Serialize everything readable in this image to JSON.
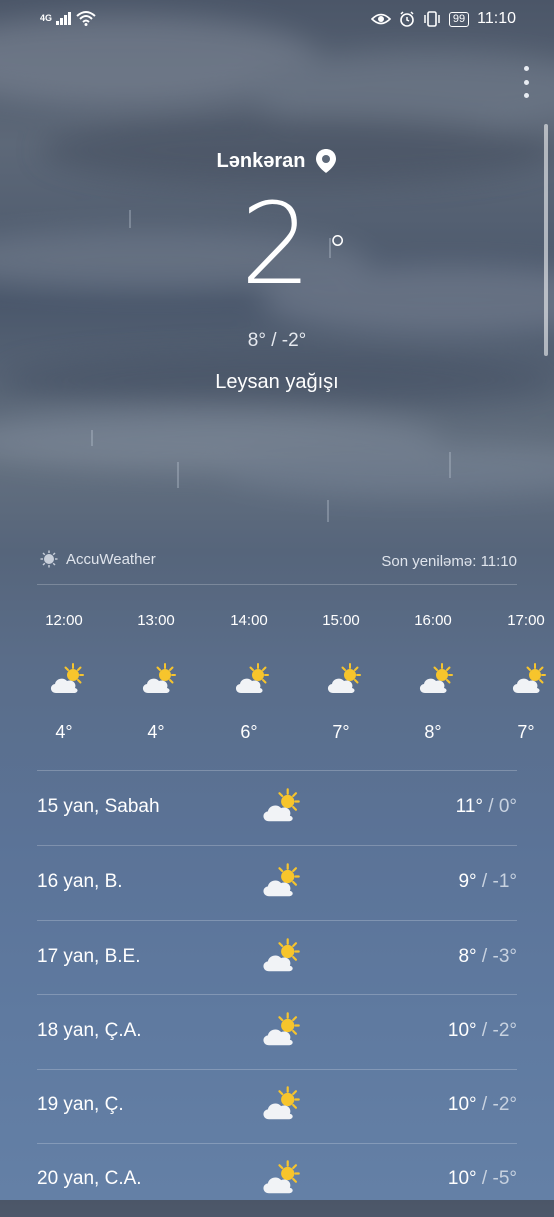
{
  "status": {
    "network": "4G",
    "time": "11:10",
    "battery": "99"
  },
  "location": "Lənkəran",
  "current": {
    "temp": "2",
    "degree": "°",
    "hi_lo": "8° / -2°",
    "condition": "Leysan yağışı"
  },
  "source": "AccuWeather",
  "last_updated": "Son yeniləmə: 11:10",
  "hourly": [
    {
      "time": "12:00",
      "temp": "4°",
      "icon": "partly-sunny-icon"
    },
    {
      "time": "13:00",
      "temp": "4°",
      "icon": "partly-sunny-icon"
    },
    {
      "time": "14:00",
      "temp": "6°",
      "icon": "partly-sunny-icon"
    },
    {
      "time": "15:00",
      "temp": "7°",
      "icon": "partly-sunny-icon"
    },
    {
      "time": "16:00",
      "temp": "8°",
      "icon": "partly-sunny-icon"
    },
    {
      "time": "17:00",
      "temp": "7°",
      "icon": "partly-sunny-icon"
    }
  ],
  "daily": [
    {
      "day": "15 yan, Sabah",
      "high": "11°",
      "low": " / 0°",
      "icon": "partly-sunny-icon"
    },
    {
      "day": "16 yan, B.",
      "high": "9°",
      "low": " / -1°",
      "icon": "partly-sunny-icon"
    },
    {
      "day": "17 yan, B.E.",
      "high": "8°",
      "low": " / -3°",
      "icon": "partly-sunny-icon"
    },
    {
      "day": "18 yan, Ç.A.",
      "high": "10°",
      "low": " / -2°",
      "icon": "partly-sunny-icon"
    },
    {
      "day": "19 yan, Ç.",
      "high": "10°",
      "low": " / -2°",
      "icon": "partly-sunny-icon"
    },
    {
      "day": "20 yan, C.A.",
      "high": "10°",
      "low": " / -5°",
      "icon": "partly-sunny-icon"
    }
  ]
}
